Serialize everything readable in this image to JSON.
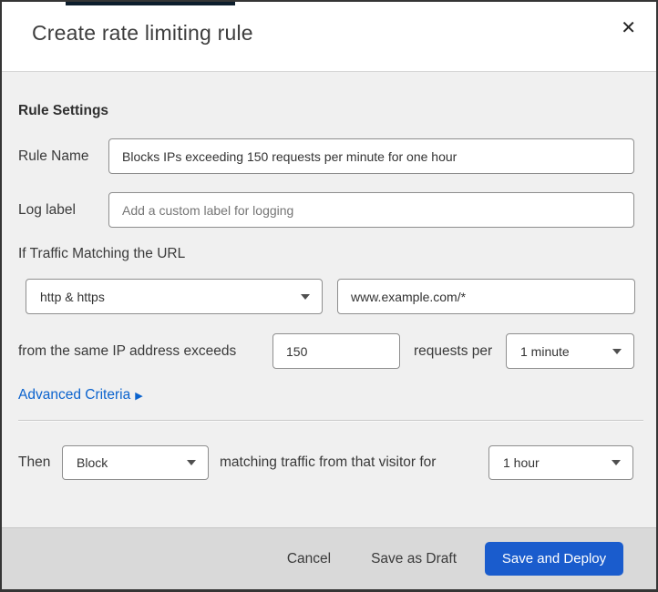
{
  "dialog": {
    "title": "Create rate limiting rule",
    "close_glyph": "✕"
  },
  "rule_settings": {
    "heading": "Rule Settings",
    "rule_name_label": "Rule Name",
    "rule_name_value": "Blocks IPs exceeding 150 requests per minute for one hour",
    "log_label": "Log label",
    "log_placeholder": "Add a custom label for logging",
    "traffic_intro": "If Traffic Matching the URL",
    "scheme_selected": "http & https",
    "url_value": "www.example.com/*",
    "exceeds_text": "from the same IP address exceeds",
    "request_count": "150",
    "requests_per_text": "requests per",
    "period_selected": "1 minute",
    "advanced_link": "Advanced Criteria",
    "advanced_arrow": "▶"
  },
  "then_section": {
    "then_label": "Then",
    "action_selected": "Block",
    "middle_text": "matching traffic from that visitor for",
    "duration_selected": "1 hour"
  },
  "footer": {
    "cancel": "Cancel",
    "save_draft": "Save as Draft",
    "save_deploy": "Save and Deploy"
  },
  "colors": {
    "link_blue": "#0b63ce",
    "primary_button_blue": "#1a5ccd",
    "body_gray": "#f0f0f0",
    "footer_gray": "#d9d9d9",
    "top_strip_navy": "#0d1e2d"
  }
}
